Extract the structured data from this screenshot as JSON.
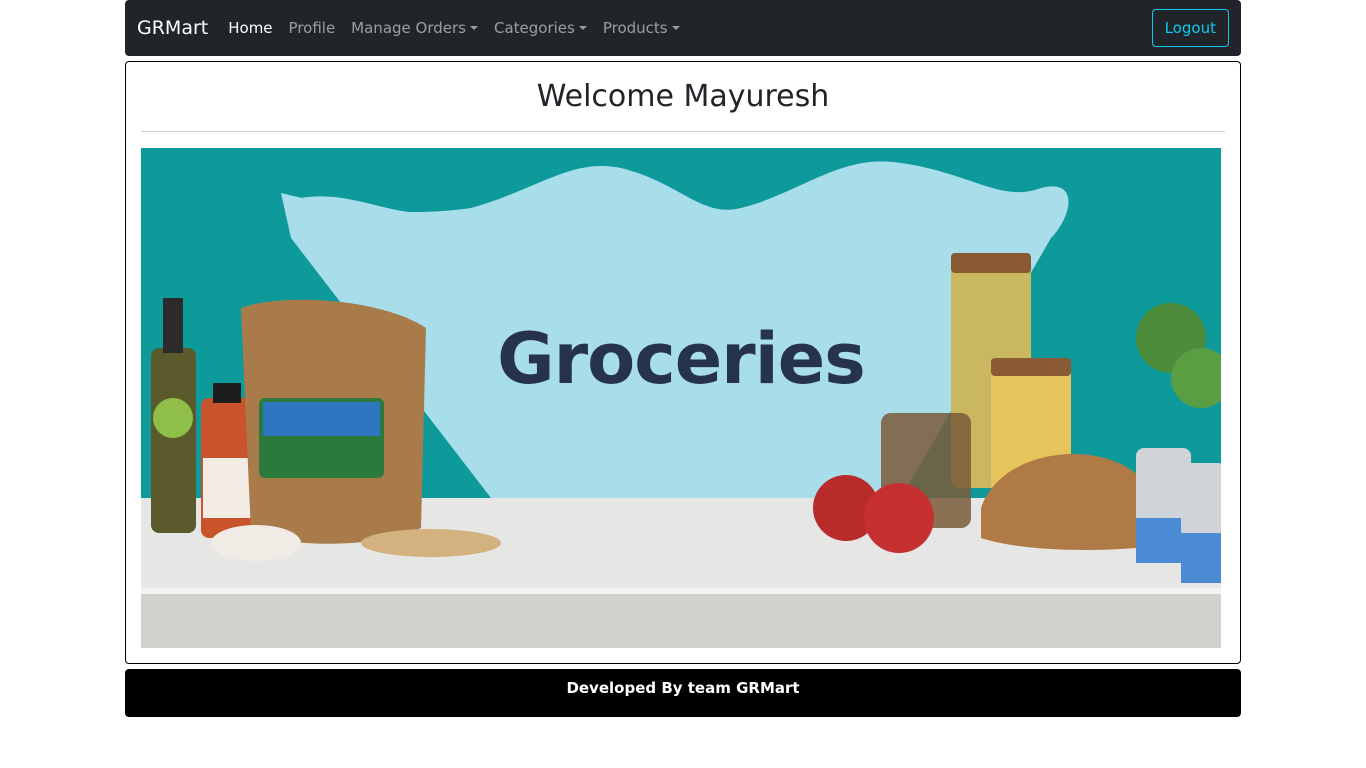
{
  "navbar": {
    "brand": "GRMart",
    "items": [
      {
        "label": "Home",
        "active": true,
        "dropdown": false
      },
      {
        "label": "Profile",
        "active": false,
        "dropdown": false
      },
      {
        "label": "Manage Orders",
        "active": false,
        "dropdown": true
      },
      {
        "label": "Categories",
        "active": false,
        "dropdown": true
      },
      {
        "label": "Products",
        "active": false,
        "dropdown": true
      }
    ],
    "logout_label": "Logout"
  },
  "main": {
    "welcome": "Welcome Mayuresh",
    "banner_text": "Groceries"
  },
  "footer": {
    "text": "Developed By team GRMart"
  },
  "colors": {
    "navbar_bg": "#212529",
    "accent": "#0dcaf0",
    "banner_teal": "#0e9a9a",
    "banner_light": "#a8ddea"
  }
}
